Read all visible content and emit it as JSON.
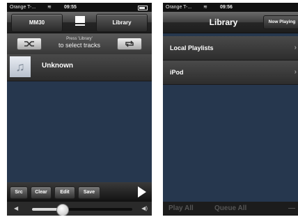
{
  "left_screen": {
    "status": {
      "carrier": "Orange T-...",
      "time": "09:55"
    },
    "nav": {
      "left_button": "MM30",
      "right_button": "Library"
    },
    "hint": {
      "line1": "Press 'Library'",
      "line2": "to select tracks"
    },
    "track": {
      "title": "Unknown"
    },
    "bottom_buttons": {
      "src": "Src",
      "clear": "Clear",
      "edit": "Edit",
      "save": "Save"
    },
    "volume": {
      "value": "30",
      "level": 0.3
    }
  },
  "right_screen": {
    "status": {
      "carrier": "Orange T-...",
      "time": "09:56"
    },
    "nav": {
      "title": "Library",
      "right_button": "Now Playing"
    },
    "rows": [
      {
        "label": "Local Playlists"
      },
      {
        "label": "iPod"
      }
    ],
    "bottom": {
      "play_all": "Play All",
      "queue_all": "Queue All"
    }
  },
  "icons": {
    "shuffle": "shuffle-icon",
    "repeat": "repeat-icon",
    "play": "play-icon",
    "music_note": "music-note-icon",
    "volume_low": "speaker-low-icon",
    "volume_high": "speaker-high-icon"
  },
  "colors": {
    "background": "#26374e",
    "navbar": "#3e3e3e"
  }
}
